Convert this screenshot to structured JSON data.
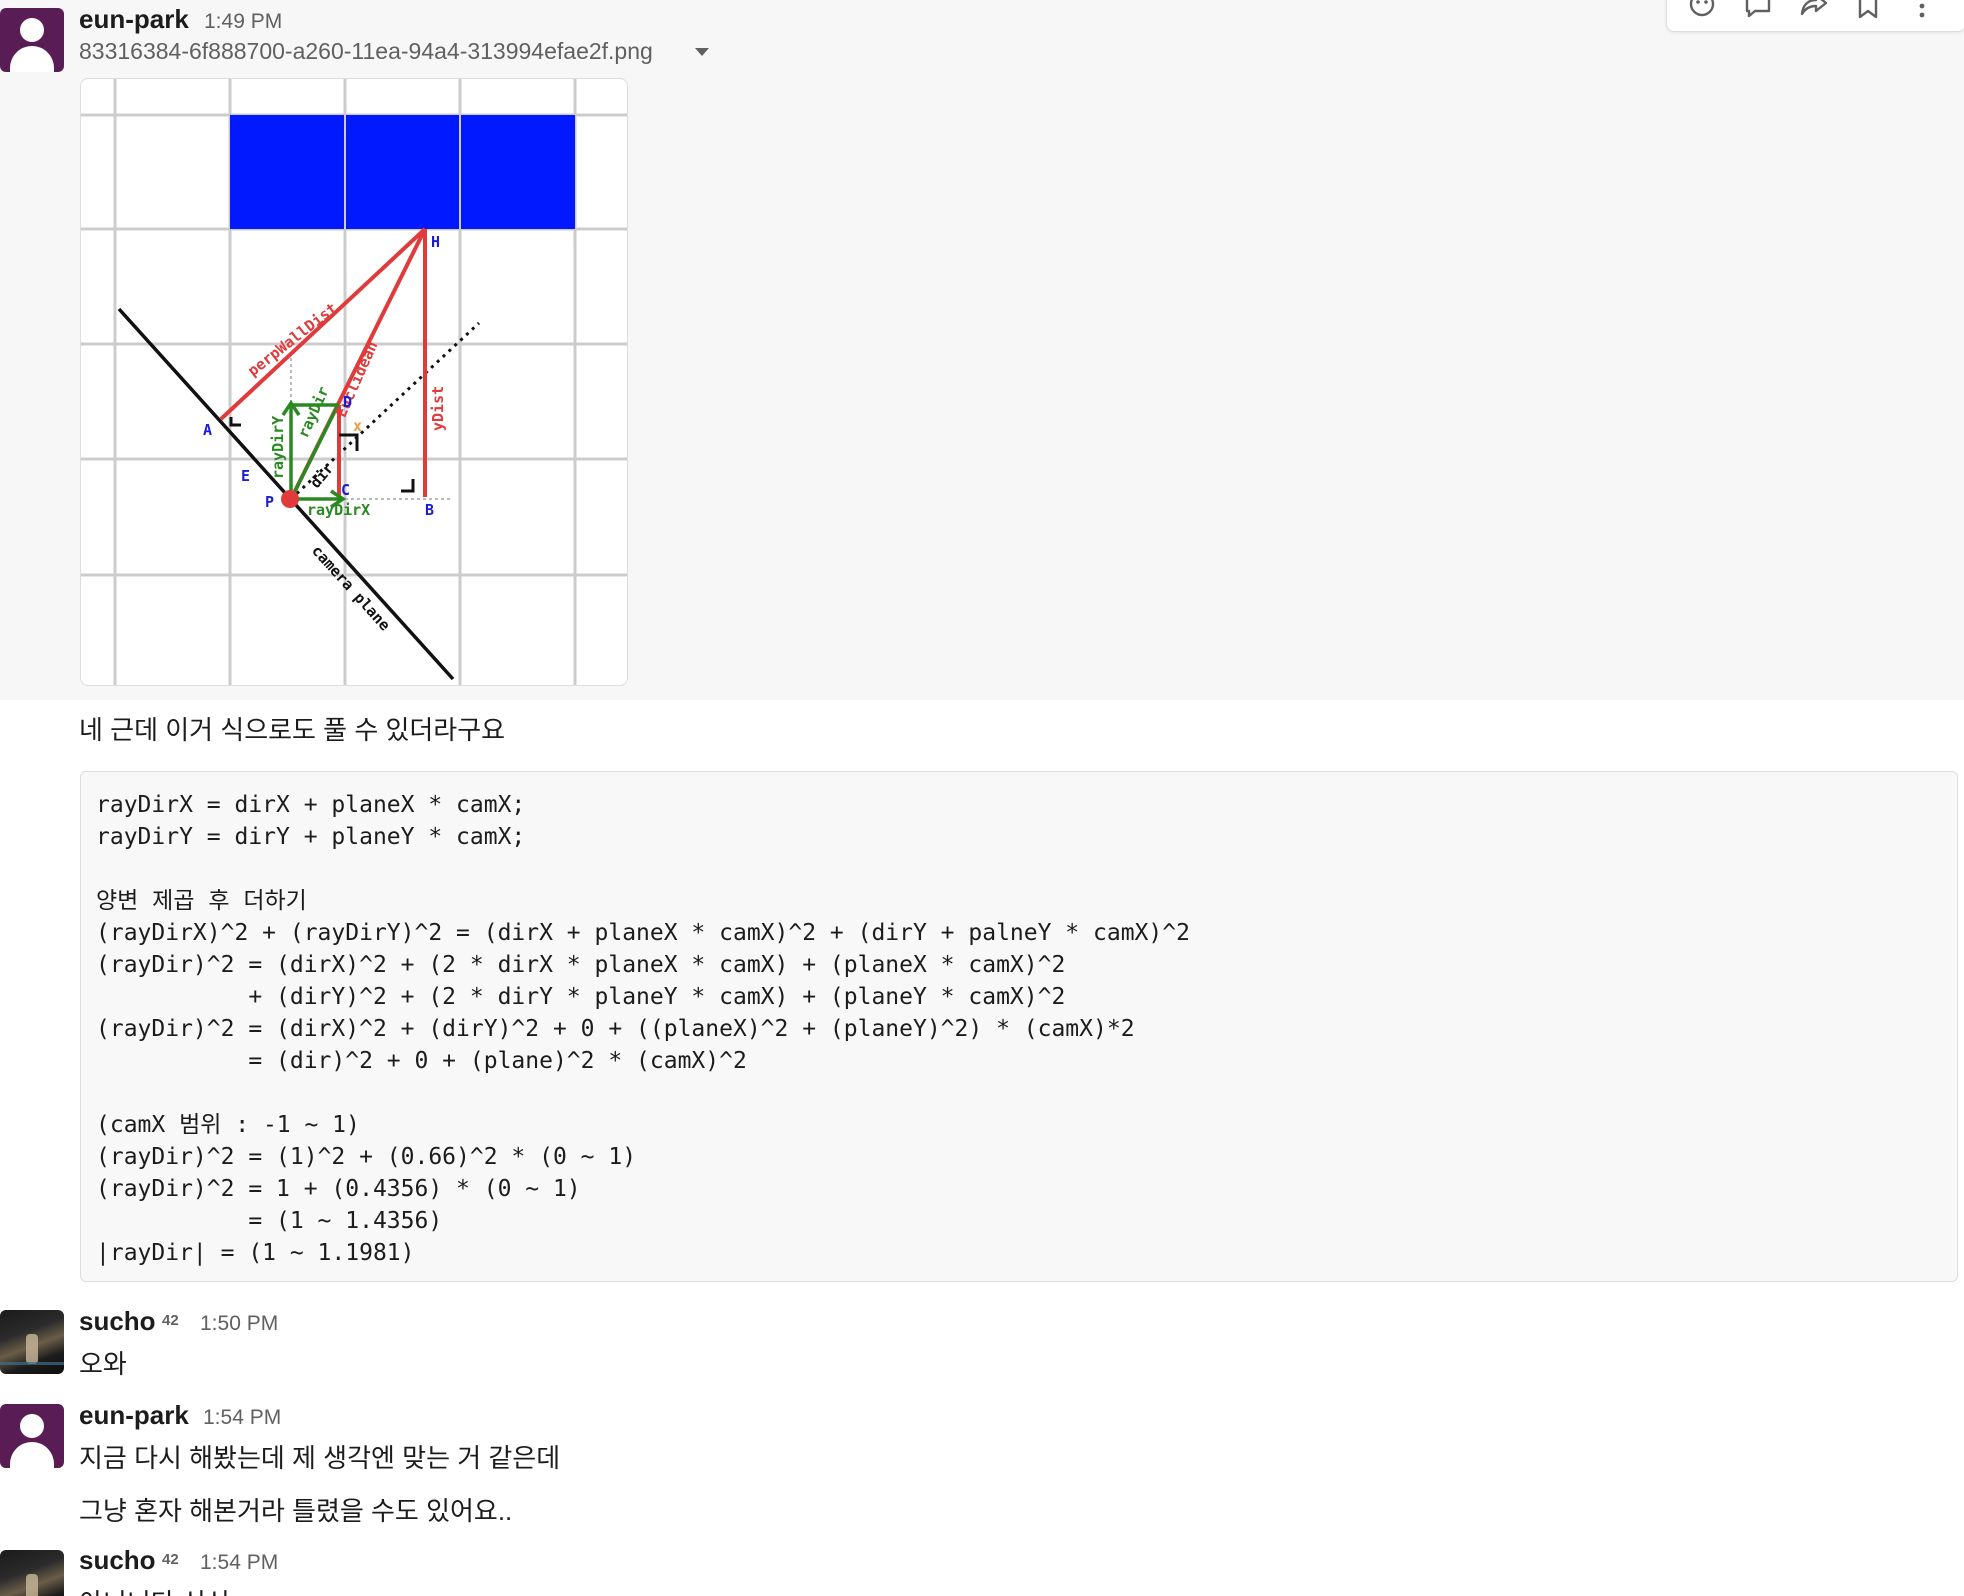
{
  "toolbar": {
    "icons": [
      "add-reaction-icon",
      "reply-in-thread-icon",
      "share-message-icon",
      "bookmark-icon",
      "more-actions-icon"
    ]
  },
  "messages": [
    {
      "author": "eun-park",
      "time": "1:49 PM",
      "file": {
        "name": "83316384-6f888700-a260-11ea-94a4-313994efae2f.png"
      },
      "figure": {
        "labels": {
          "perp_wall_dist": "perpWallDist",
          "euclidean": "Euclidean",
          "y_dist": "yDist",
          "ray_dir_y": "rayDirY",
          "ray_dir": "rayDir",
          "ray_dir_x": "rayDirX",
          "dir": "dir",
          "camera_plane": "camera plane",
          "x": "x",
          "h": "H",
          "a": "A",
          "d": "D",
          "e": "E",
          "p": "P",
          "c": "C",
          "b": "B"
        },
        "colors": {
          "wall": "#0019ff",
          "ray": "#e03a3a",
          "green": "#2a8a22",
          "point_label": "#1c1cd6",
          "grid": "#cccccc"
        }
      },
      "body": [
        "네 근데 이거 식으로도 풀 수 있더라구요"
      ],
      "code": [
        "rayDirX = dirX + planeX * camX;",
        "rayDirY = dirY + planeY * camX;",
        "",
        "양변 제곱 후 더하기",
        "(rayDirX)^2 + (rayDirY)^2 = (dirX + planeX * camX)^2 + (dirY + palneY * camX)^2",
        "(rayDir)^2 = (dirX)^2 + (2 * dirX * planeX * camX) + (planeX * camX)^2",
        "           + (dirY)^2 + (2 * dirY * planeY * camX) + (planeY * camX)^2",
        "(rayDir)^2 = (dirX)^2 + (dirY)^2 + 0 + ((planeX)^2 + (planeY)^2) * (camX)*2",
        "           = (dir)^2 + 0 + (plane)^2 * (camX)^2",
        "",
        "(camX 범위 : -1 ~ 1)",
        "(rayDir)^2 = (1)^2 + (0.66)^2 * (0 ~ 1)",
        "(rayDir)^2 = 1 + (0.4356) * (0 ~ 1)",
        "           = (1 ~ 1.4356)",
        "|rayDir| = (1 ~ 1.1981)"
      ]
    },
    {
      "author": "sucho",
      "badge": "42",
      "time": "1:50 PM",
      "body": [
        "오와"
      ]
    },
    {
      "author": "eun-park",
      "time": "1:54 PM",
      "body": [
        "지금 다시 해봤는데 제 생각엔 맞는 거 같은데",
        "그냥 혼자 해본거라 틀렸을 수도 있어요.."
      ]
    },
    {
      "author": "sucho",
      "badge": "42",
      "time": "1:54 PM",
      "body": [
        "아니니다 신신"
      ]
    }
  ]
}
